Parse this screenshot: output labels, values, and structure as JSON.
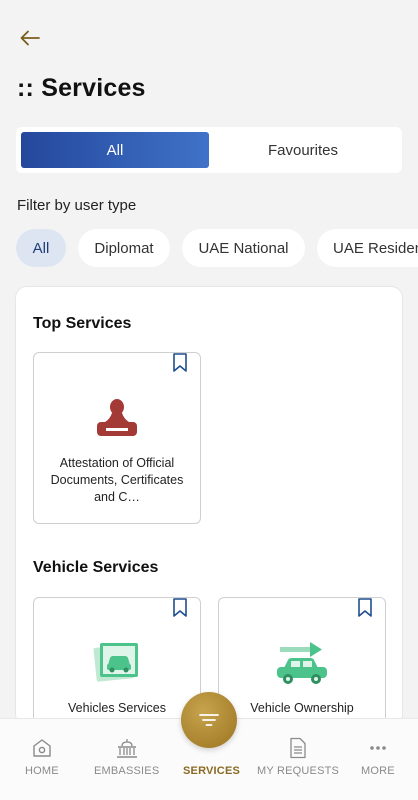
{
  "header": {
    "title": ":: Services"
  },
  "tabs": {
    "all_label": "All",
    "favourites_label": "Favourites",
    "active": "All"
  },
  "filter": {
    "label": "Filter by user type",
    "chips": [
      "All",
      "Diplomat",
      "UAE National",
      "UAE Residen"
    ],
    "active_chip": "All"
  },
  "sections": {
    "top": {
      "title": "Top Services",
      "items": [
        {
          "label": "Attestation of Official Documents, Certificates and C…",
          "icon": "stamp-icon"
        }
      ]
    },
    "vehicle": {
      "title": "Vehicle Services",
      "items": [
        {
          "label": "Vehicles Services",
          "icon": "vehicle-photo-icon"
        },
        {
          "label": "Vehicle Ownership",
          "icon": "vehicle-transfer-icon"
        }
      ]
    }
  },
  "bottom_nav": {
    "home": "HOME",
    "embassies": "EMBASSIES",
    "services": "SERVICES",
    "my_requests": "MY REQUESTS",
    "more": "MORE",
    "active": "SERVICES"
  },
  "colors": {
    "primary_blue": "#24489c",
    "gold": "#a9822e",
    "stamp_red": "#a33a36",
    "vehicle_green": "#4cc38a",
    "bookmark_blue": "#1f4f8f"
  }
}
